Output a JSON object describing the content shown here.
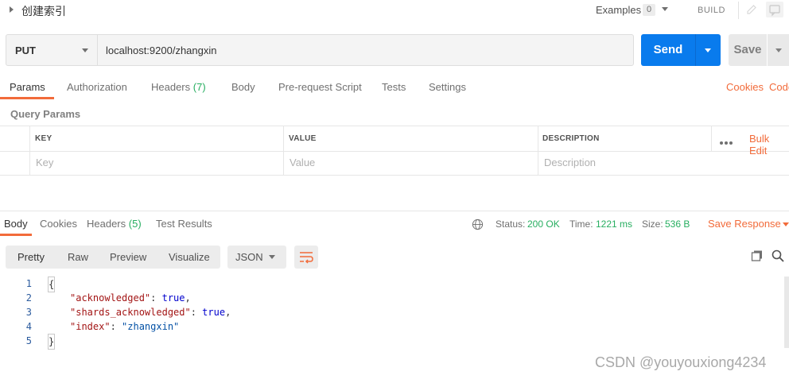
{
  "header": {
    "title": "创建索引",
    "examples_label": "Examples",
    "examples_count": "0",
    "build_label": "BUILD"
  },
  "request": {
    "method": "PUT",
    "url": "localhost:9200/zhangxin",
    "send_label": "Send",
    "save_label": "Save"
  },
  "request_tabs": {
    "params": "Params",
    "authorization": "Authorization",
    "headers": "Headers",
    "headers_count": "(7)",
    "body": "Body",
    "prerequest": "Pre-request Script",
    "tests": "Tests",
    "settings": "Settings",
    "cookies": "Cookies",
    "code": "Code"
  },
  "query_params": {
    "section_label": "Query Params",
    "col_key": "KEY",
    "col_value": "VALUE",
    "col_description": "DESCRIPTION",
    "bulk_edit": "Bulk Edit",
    "key_placeholder": "Key",
    "value_placeholder": "Value",
    "description_placeholder": "Description"
  },
  "response_tabs": {
    "body": "Body",
    "cookies": "Cookies",
    "headers": "Headers",
    "headers_count": "(5)",
    "test_results": "Test Results"
  },
  "response_meta": {
    "status_label": "Status:",
    "status_value": "200 OK",
    "time_label": "Time:",
    "time_value": "1221 ms",
    "size_label": "Size:",
    "size_value": "536 B",
    "save_response": "Save Response"
  },
  "view_modes": {
    "pretty": "Pretty",
    "raw": "Raw",
    "preview": "Preview",
    "visualize": "Visualize",
    "format": "JSON"
  },
  "code": {
    "line_numbers": [
      "1",
      "2",
      "3",
      "4",
      "5"
    ],
    "open_brace": "{",
    "close_brace": "}",
    "lines": [
      {
        "key": "\"acknowledged\"",
        "sep": ": ",
        "value": "true",
        "tail": ","
      },
      {
        "key": "\"shards_acknowledged\"",
        "sep": ": ",
        "value": "true",
        "tail": ","
      },
      {
        "key": "\"index\"",
        "sep": ": ",
        "value": "\"zhangxin\"",
        "tail": ""
      }
    ]
  },
  "watermark": "CSDN @youyouxiong4234",
  "colors": {
    "accent_orange": "#f26b3a",
    "send_blue": "#097bed",
    "status_green": "#27ae60"
  }
}
